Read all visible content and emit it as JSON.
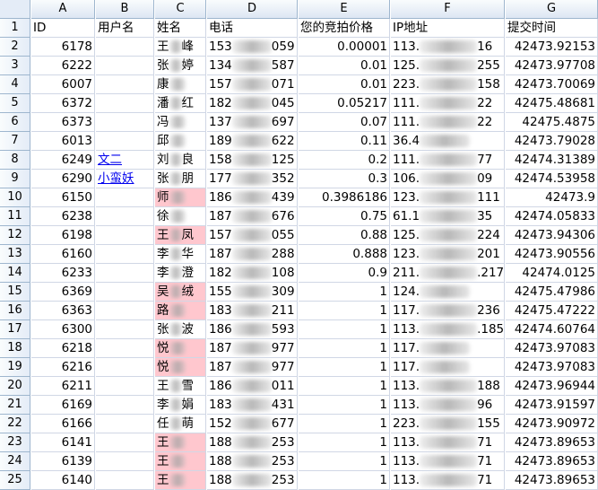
{
  "columns": [
    "A",
    "B",
    "C",
    "D",
    "E",
    "F",
    "G"
  ],
  "header_row_number": "1",
  "headers": [
    "ID",
    "用户名",
    "姓名",
    "电话",
    "您的竞拍价格",
    "IP地址",
    "提交时间"
  ],
  "colors": {
    "highlight": "#ffc7ce",
    "link": "#0000ee",
    "grid": "#d0d7e5",
    "header_bg": "#dde6f3"
  },
  "rows": [
    {
      "n": "2",
      "id": "6178",
      "user": "",
      "name_a": "王",
      "name_b": "峰",
      "pink": false,
      "phone_a": "153",
      "phone_b": "059",
      "bid": "0.00001",
      "ip_a": "113.",
      "ip_b": "16",
      "time": "42473.92153"
    },
    {
      "n": "3",
      "id": "6222",
      "user": "",
      "name_a": "张",
      "name_b": "婷",
      "pink": false,
      "phone_a": "134",
      "phone_b": "587",
      "bid": "0.01",
      "ip_a": "125.",
      "ip_b": "255",
      "time": "42473.97708"
    },
    {
      "n": "4",
      "id": "6007",
      "user": "",
      "name_a": "康",
      "name_b": "",
      "pink": false,
      "phone_a": "157",
      "phone_b": "071",
      "bid": "0.01",
      "ip_a": "223.",
      "ip_b": "158",
      "time": "42473.70069"
    },
    {
      "n": "5",
      "id": "6372",
      "user": "",
      "name_a": "潘",
      "name_b": "红",
      "pink": false,
      "phone_a": "182",
      "phone_b": "045",
      "bid": "0.05217",
      "ip_a": "111.",
      "ip_b": "22",
      "time": "42475.48681"
    },
    {
      "n": "6",
      "id": "6373",
      "user": "",
      "name_a": "冯",
      "name_b": "",
      "pink": false,
      "phone_a": "137",
      "phone_b": "697",
      "bid": "0.07",
      "ip_a": "111.",
      "ip_b": "22",
      "time": "42475.4875"
    },
    {
      "n": "7",
      "id": "6013",
      "user": "",
      "name_a": "邱",
      "name_b": "",
      "pink": false,
      "phone_a": "189",
      "phone_b": "622",
      "bid": "0.11",
      "ip_a": "36.4",
      "ip_b": "",
      "time": "42473.79028"
    },
    {
      "n": "8",
      "id": "6249",
      "user": "文二",
      "name_a": "刘",
      "name_b": "良",
      "pink": false,
      "phone_a": "158",
      "phone_b": "125",
      "bid": "0.2",
      "ip_a": "111.",
      "ip_b": "77",
      "time": "42474.31389"
    },
    {
      "n": "9",
      "id": "6290",
      "user": "小蛮妖",
      "name_a": "张",
      "name_b": "朋",
      "pink": false,
      "phone_a": "177",
      "phone_b": "352",
      "bid": "0.3",
      "ip_a": "106.",
      "ip_b": "09",
      "time": "42474.53958"
    },
    {
      "n": "10",
      "id": "6150",
      "user": "",
      "name_a": "师",
      "name_b": "",
      "pink": true,
      "phone_a": "186",
      "phone_b": "439",
      "bid": "0.3986186",
      "ip_a": "123.",
      "ip_b": "111",
      "time": "42473.9"
    },
    {
      "n": "11",
      "id": "6238",
      "user": "",
      "name_a": "徐",
      "name_b": "",
      "pink": false,
      "phone_a": "187",
      "phone_b": "676",
      "bid": "0.75",
      "ip_a": "61.1",
      "ip_b": "35",
      "time": "42474.05833"
    },
    {
      "n": "12",
      "id": "6198",
      "user": "",
      "name_a": "王",
      "name_b": "凤",
      "pink": true,
      "phone_a": "157",
      "phone_b": "055",
      "bid": "0.88",
      "ip_a": "125.",
      "ip_b": "224",
      "time": "42473.94306"
    },
    {
      "n": "13",
      "id": "6160",
      "user": "",
      "name_a": "李",
      "name_b": "华",
      "pink": false,
      "phone_a": "187",
      "phone_b": "288",
      "bid": "0.888",
      "ip_a": "123.",
      "ip_b": "201",
      "time": "42473.90556"
    },
    {
      "n": "14",
      "id": "6233",
      "user": "",
      "name_a": "李",
      "name_b": "澄",
      "pink": false,
      "phone_a": "182",
      "phone_b": "108",
      "bid": "0.9",
      "ip_a": "211.",
      "ip_b": ".217",
      "time": "42474.0125"
    },
    {
      "n": "15",
      "id": "6369",
      "user": "",
      "name_a": "吴",
      "name_b": "绒",
      "pink": true,
      "phone_a": "155",
      "phone_b": "309",
      "bid": "1",
      "ip_a": "124.",
      "ip_b": "",
      "time": "42475.47986"
    },
    {
      "n": "16",
      "id": "6363",
      "user": "",
      "name_a": "路",
      "name_b": "",
      "pink": true,
      "phone_a": "183",
      "phone_b": "211",
      "bid": "1",
      "ip_a": "117.",
      "ip_b": "236",
      "time": "42475.47222"
    },
    {
      "n": "17",
      "id": "6300",
      "user": "",
      "name_a": "张",
      "name_b": "波",
      "pink": false,
      "phone_a": "186",
      "phone_b": "593",
      "bid": "1",
      "ip_a": "113.",
      "ip_b": ".185",
      "time": "42474.60764"
    },
    {
      "n": "18",
      "id": "6218",
      "user": "",
      "name_a": "悦",
      "name_b": "",
      "pink": true,
      "phone_a": "187",
      "phone_b": "977",
      "bid": "1",
      "ip_a": "117.",
      "ip_b": "",
      "time": "42473.97083"
    },
    {
      "n": "19",
      "id": "6216",
      "user": "",
      "name_a": "悦",
      "name_b": "",
      "pink": true,
      "phone_a": "187",
      "phone_b": "977",
      "bid": "1",
      "ip_a": "117.",
      "ip_b": "",
      "time": "42473.97083"
    },
    {
      "n": "20",
      "id": "6211",
      "user": "",
      "name_a": "王",
      "name_b": "雪",
      "pink": false,
      "phone_a": "186",
      "phone_b": "011",
      "bid": "1",
      "ip_a": "113.",
      "ip_b": "188",
      "time": "42473.96944"
    },
    {
      "n": "21",
      "id": "6169",
      "user": "",
      "name_a": "李",
      "name_b": "娟",
      "pink": false,
      "phone_a": "183",
      "phone_b": "431",
      "bid": "1",
      "ip_a": "113.",
      "ip_b": "96",
      "time": "42473.91597"
    },
    {
      "n": "22",
      "id": "6166",
      "user": "",
      "name_a": "任",
      "name_b": "萌",
      "pink": false,
      "phone_a": "152",
      "phone_b": "677",
      "bid": "1",
      "ip_a": "223.",
      "ip_b": "155",
      "time": "42473.90972"
    },
    {
      "n": "23",
      "id": "6141",
      "user": "",
      "name_a": "王",
      "name_b": "",
      "pink": true,
      "phone_a": "188",
      "phone_b": "253",
      "bid": "1",
      "ip_a": "113.",
      "ip_b": "71",
      "time": "42473.89653"
    },
    {
      "n": "24",
      "id": "6139",
      "user": "",
      "name_a": "王",
      "name_b": "",
      "pink": true,
      "phone_a": "188",
      "phone_b": "253",
      "bid": "1",
      "ip_a": "113.",
      "ip_b": "71",
      "time": "42473.89653"
    },
    {
      "n": "25",
      "id": "6140",
      "user": "",
      "name_a": "王",
      "name_b": "",
      "pink": true,
      "phone_a": "188",
      "phone_b": "253",
      "bid": "1",
      "ip_a": "113.",
      "ip_b": "71",
      "time": "42473.89653"
    }
  ]
}
